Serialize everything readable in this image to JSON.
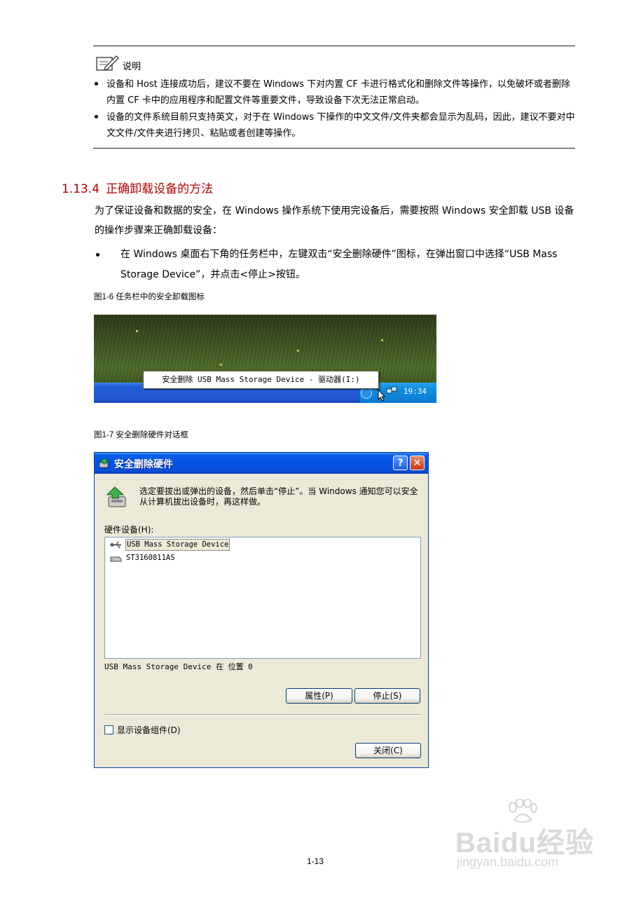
{
  "note": {
    "title": "说明",
    "bullets": [
      "设备和 Host 连接成功后，建议不要在 Windows 下对内置 CF 卡进行格式化和删除文件等操作，以免破坏或者删除内置 CF 卡中的应用程序和配置文件等重要文件，导致设备下次无法正常启动。",
      "设备的文件系统目前只支持英文，对于在 Windows 下操作的中文文件/文件夹都会显示为乱码，因此，建议不要对中文文件/文件夹进行拷贝、粘贴或者创建等操作。"
    ]
  },
  "section": {
    "number": "1.13.4",
    "title": "正确卸载设备的方法",
    "paragraph": "为了保证设备和数据的安全，在 Windows 操作系统下使用完设备后，需要按照 Windows 安全卸载 USB 设备的操作步骤来正确卸载设备：",
    "step": "在 Windows 桌面右下角的任务栏中，左键双击“安全删除硬件”图标，在弹出窗口中选择“USB Mass Storage Device”，并点击<停止>按钮。"
  },
  "figure1": {
    "caption": "图1-6 任务栏中的安全卸载图标",
    "tooltip": "安全删除 USB Mass Storage Device - 驱动器(I:)",
    "clock": "19:34"
  },
  "figure2": {
    "caption": "图1-7 安全删除硬件对话框",
    "dialog": {
      "title": "安全删除硬件",
      "help_button": "?",
      "close_x": "✕",
      "intro": "选定要拔出或弹出的设备，然后单击“停止”。当 Windows 通知您可以安全从计算机拔出设备时，再这样做。",
      "devices_label": "硬件设备(H):",
      "devices": [
        "USB Mass Storage Device",
        "ST3160811AS"
      ],
      "selected_device": "USB Mass Storage Device",
      "location": "USB Mass Storage Device 在 位置 0",
      "properties_button": "属性(P)",
      "stop_button": "停止(S)",
      "show_components": "显示设备组件(D)",
      "show_components_checked": false,
      "close_button": "关闭(C)"
    }
  },
  "page_number": "1-13",
  "watermark": {
    "brand": "Baidu经验",
    "url": "jingyan.baidu.com"
  }
}
